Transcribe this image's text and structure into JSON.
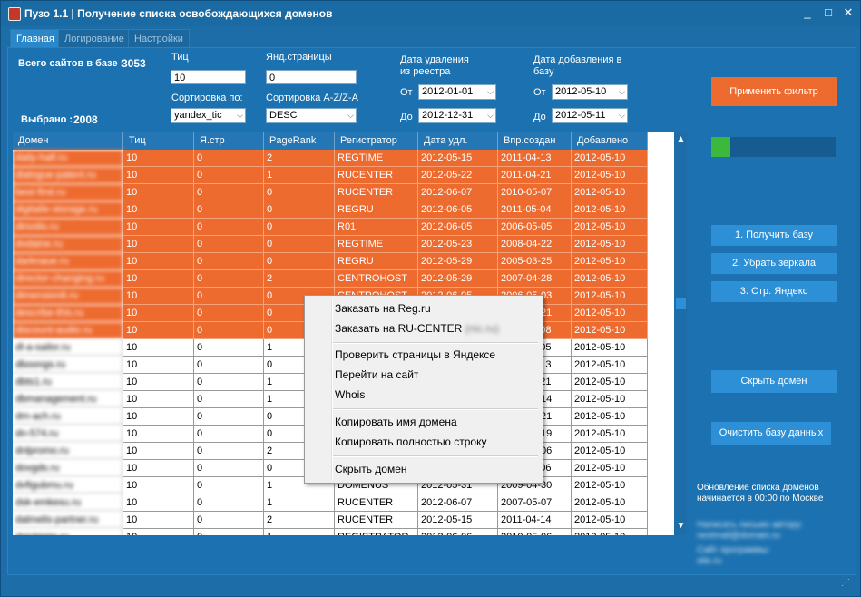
{
  "window": {
    "title": "Пузо 1.1 | Получение списка освобождающихся доменов",
    "minimize": "_",
    "maximize": "□",
    "close": "✕"
  },
  "tabs": [
    {
      "label": "Главная"
    },
    {
      "label": "Логирование"
    },
    {
      "label": "Настройки"
    }
  ],
  "stats": {
    "total_label": "Всего сайтов в базе :",
    "total_value": "3053",
    "selected_label": "Выбрано :",
    "selected_value": "2008"
  },
  "filters": {
    "tic_label": "Тиц",
    "tic_value": "10",
    "yandex_pages_label": "Янд.страницы",
    "yandex_pages_value": "0",
    "sort_label": "Сортировка по:",
    "sort_value": "yandex_tic",
    "sort_dir_label": "Сортировка A-Z/Z-A",
    "sort_dir_value": "DESC",
    "delete_date_label": "Дата удаления из реестра",
    "add_date_label": "Дата добавления в базу",
    "from_label": "От",
    "to_label": "До",
    "delete_from": "2012-01-01",
    "delete_to": "2012-12-31",
    "add_from": "2012-05-10",
    "add_to": "2012-05-11"
  },
  "buttons": {
    "apply_filter": "Применить фильтр",
    "get_base": "1. Получить базу",
    "remove_mirrors": "2. Убрать зеркала",
    "yandex_pages": "3. Стр. Яндекс",
    "hide_domain": "Скрыть домен",
    "clear_db": "Очистить базу данных"
  },
  "progress": {
    "value": 0.15,
    "color": "#3cb93c"
  },
  "table": {
    "columns": [
      "Домен",
      "Тиц",
      "Я.стр",
      "PageRank",
      "Регистратор",
      "Дата удл.",
      "Впр.создан",
      "Добавлено"
    ],
    "rows": [
      {
        "domain": "daily-half.ru",
        "tic": "10",
        "ystr": "0",
        "pr": "2",
        "reg": "REGTIME",
        "del": "2012-05-15",
        "created": "2011-04-13",
        "added": "2012-05-10",
        "hl": true
      },
      {
        "domain": "dialogue-patent.ru",
        "tic": "10",
        "ystr": "0",
        "pr": "1",
        "reg": "RUCENTER",
        "del": "2012-05-22",
        "created": "2011-04-21",
        "added": "2012-05-10",
        "hl": true
      },
      {
        "domain": "best-find.ru",
        "tic": "10",
        "ystr": "0",
        "pr": "0",
        "reg": "RUCENTER",
        "del": "2012-06-07",
        "created": "2010-05-07",
        "added": "2012-05-10",
        "hl": true
      },
      {
        "domain": "digitalle-storage.ru",
        "tic": "10",
        "ystr": "0",
        "pr": "0",
        "reg": "REGRU",
        "del": "2012-06-05",
        "created": "2011-05-04",
        "added": "2012-05-10",
        "hl": true
      },
      {
        "domain": "dinodis.ru",
        "tic": "10",
        "ystr": "0",
        "pr": "0",
        "reg": "R01",
        "del": "2012-06-05",
        "created": "2006-05-05",
        "added": "2012-05-10",
        "hl": true
      },
      {
        "domain": "dodaine.ru",
        "tic": "10",
        "ystr": "0",
        "pr": "0",
        "reg": "REGTIME",
        "del": "2012-05-23",
        "created": "2008-04-22",
        "added": "2012-05-10",
        "hl": true
      },
      {
        "domain": "darknaue.ru",
        "tic": "10",
        "ystr": "0",
        "pr": "0",
        "reg": "REGRU",
        "del": "2012-05-29",
        "created": "2005-03-25",
        "added": "2012-05-10",
        "hl": true
      },
      {
        "domain": "director-changing.ru",
        "tic": "10",
        "ystr": "0",
        "pr": "2",
        "reg": "CENTROHOST",
        "del": "2012-05-29",
        "created": "2007-04-28",
        "added": "2012-05-10",
        "hl": true
      },
      {
        "domain": "dimension8.ru",
        "tic": "10",
        "ystr": "0",
        "pr": "0",
        "reg": "CENTROHOST",
        "del": "2012-06-05",
        "created": "2006-05-03",
        "added": "2012-05-10",
        "hl": true
      },
      {
        "domain": "describe-this.ru",
        "tic": "10",
        "ystr": "0",
        "pr": "0",
        "reg": "",
        "del": "",
        "created": "2010-05-21",
        "added": "2012-05-10",
        "hl": true
      },
      {
        "domain": "discount-audio.ru",
        "tic": "10",
        "ystr": "0",
        "pr": "0",
        "reg": "",
        "del": "",
        "created": "2011-04-08",
        "added": "2012-05-10",
        "hl": true
      },
      {
        "domain": "dl-a-sailor.ru",
        "tic": "10",
        "ystr": "0",
        "pr": "1",
        "reg": "",
        "del": "",
        "created": "2011-04-05",
        "added": "2012-05-10",
        "hl": false
      },
      {
        "domain": "dboongs.ru",
        "tic": "10",
        "ystr": "0",
        "pr": "0",
        "reg": "",
        "del": "",
        "created": "2011-04-13",
        "added": "2012-05-10",
        "hl": false
      },
      {
        "domain": "dbts1.ru",
        "tic": "10",
        "ystr": "0",
        "pr": "1",
        "reg": "",
        "del": "",
        "created": "2011-04-21",
        "added": "2012-05-10",
        "hl": false
      },
      {
        "domain": "dbmanagement.ru",
        "tic": "10",
        "ystr": "0",
        "pr": "1",
        "reg": "",
        "del": "",
        "created": "2010-04-14",
        "added": "2012-05-10",
        "hl": false
      },
      {
        "domain": "dm-ach.ru",
        "tic": "10",
        "ystr": "0",
        "pr": "0",
        "reg": "",
        "del": "",
        "created": "2010-04-21",
        "added": "2012-05-10",
        "hl": false
      },
      {
        "domain": "dn-574.ru",
        "tic": "10",
        "ystr": "0",
        "pr": "0",
        "reg": "",
        "del": "",
        "created": "2007-04-19",
        "added": "2012-05-10",
        "hl": false
      },
      {
        "domain": "dnlpromo.ru",
        "tic": "10",
        "ystr": "0",
        "pr": "2",
        "reg": "",
        "del": "",
        "created": "2009-04-06",
        "added": "2012-05-10",
        "hl": false
      },
      {
        "domain": "dovgds.ru",
        "tic": "10",
        "ystr": "0",
        "pr": "0",
        "reg": "",
        "del": "",
        "created": "2011-05-06",
        "added": "2012-05-10",
        "hl": false
      },
      {
        "domain": "dvfigubmu.ru",
        "tic": "10",
        "ystr": "0",
        "pr": "1",
        "reg": "DOMENUS",
        "del": "2012-05-31",
        "created": "2009-04-30",
        "added": "2012-05-10",
        "hl": false
      },
      {
        "domain": "dsk-emkesu.ru",
        "tic": "10",
        "ystr": "0",
        "pr": "1",
        "reg": "RUCENTER",
        "del": "2012-06-07",
        "created": "2007-05-07",
        "added": "2012-05-10",
        "hl": false
      },
      {
        "domain": "dalmelis-partner.ru",
        "tic": "10",
        "ystr": "0",
        "pr": "2",
        "reg": "RUCENTER",
        "del": "2012-05-15",
        "created": "2011-04-14",
        "added": "2012-05-10",
        "hl": false
      },
      {
        "domain": "dpicktaim.ru",
        "tic": "10",
        "ystr": "0",
        "pr": "1",
        "reg": "REGISTRATOR",
        "del": "2012-06-06",
        "created": "2010-05-06",
        "added": "2012-05-10",
        "hl": false
      }
    ]
  },
  "context_menu": {
    "items": [
      {
        "label": "Заказать на Reg.ru"
      },
      {
        "label": "Заказать на RU-CENTER",
        "suffix": "(nic.ru)"
      },
      {
        "label": "Проверить страницы в Яндексе"
      },
      {
        "label": "Перейти на сайт"
      },
      {
        "label": "Whois"
      },
      {
        "label": "Копировать имя домена"
      },
      {
        "label": "Копировать полностью строку"
      },
      {
        "label": "Скрыть домен"
      }
    ]
  },
  "notes": {
    "update_info": "Обновление списка доменов начинается в 00:00 по Москве",
    "contact_line1": "Написать письмо автору:",
    "contact_line2": "nextmail@domain.ru",
    "site_line1": "Сайт программы:",
    "site_line2": "site.ru"
  },
  "scroll": {
    "up": "▲",
    "down": "▼"
  },
  "grip": "⋰"
}
